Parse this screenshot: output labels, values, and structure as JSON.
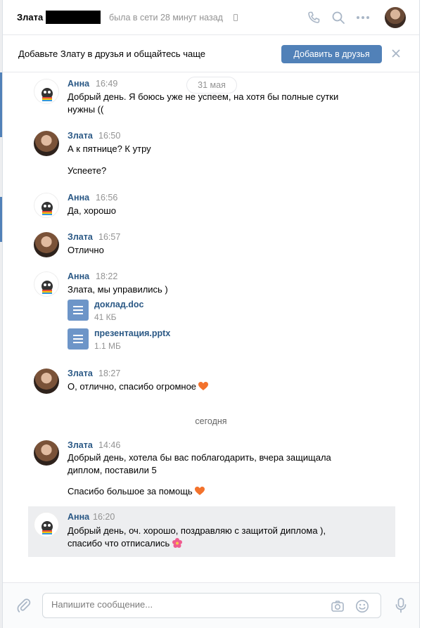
{
  "header": {
    "contact_name": "Злата",
    "status": "была в сети 28 минут назад"
  },
  "banner": {
    "text": "Добавьте Злату в друзья и общайтесь чаще",
    "add_button": "Добавить в друзья"
  },
  "dates": {
    "first": "31 мая",
    "today": "сегодня"
  },
  "messages": [
    {
      "author": "Анна",
      "time": "16:49",
      "lines": [
        "Добрый день. Я боюсь уже не успеем, на хотя бы полные сутки",
        "нужны (("
      ]
    },
    {
      "author": "Злата",
      "time": "16:50",
      "lines": [
        "А к пятнице? К утру",
        "Успеете?"
      ]
    },
    {
      "author": "Анна",
      "time": "16:56",
      "lines": [
        "Да, хорошо"
      ]
    },
    {
      "author": "Злата",
      "time": "16:57",
      "lines": [
        "Отлично"
      ]
    },
    {
      "author": "Анна",
      "time": "18:22",
      "lines": [
        "Злата, мы управились )"
      ],
      "attachments": [
        {
          "name": "доклад.doc",
          "size": "41 КБ",
          "icon": "document-icon"
        },
        {
          "name": "презентация.pptx",
          "size": "1.1 МБ",
          "icon": "document-icon"
        }
      ]
    },
    {
      "author": "Злата",
      "time": "18:27",
      "lines": [
        "О, отлично, спасибо огромное"
      ],
      "emoji": "orange-heart"
    },
    {
      "author": "Злата",
      "time": "14:46",
      "lines": [
        "Добрый день, хотела бы вас поблагодарить, вчера защищала",
        "диплом, поставили 5",
        "Спасибо большое за помощь"
      ],
      "emoji": "orange-heart"
    },
    {
      "author": "Анна",
      "time": "16:20",
      "lines": [
        "Добрый день, оч. хорошо, поздравляю с защитой диплома ),",
        "спасибо что отписались"
      ],
      "emoji": "flower",
      "highlighted": true
    }
  ],
  "composer": {
    "placeholder": "Напишите сообщение..."
  },
  "colors": {
    "accent": "#5181b8",
    "link": "#2a5885",
    "muted": "#939393",
    "icon": "#a9b6c6"
  }
}
